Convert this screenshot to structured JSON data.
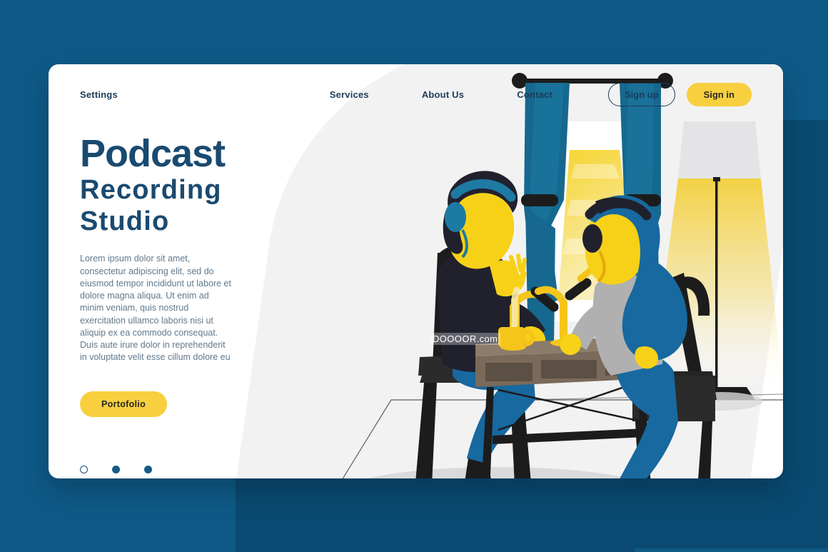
{
  "page": {
    "background_color": "#0e5a87",
    "blob_color": "#0a4a72",
    "card_color": "#ffffff"
  },
  "nav": {
    "brand": "Settings",
    "links": [
      {
        "label": "Services"
      },
      {
        "label": "About Us"
      },
      {
        "label": "Contact"
      }
    ],
    "sign_up": "Sign up",
    "sign_in": "Sign in",
    "accent_color": "#f7cf3f",
    "text_color": "#1d3c59"
  },
  "hero": {
    "title": "Podcast",
    "subtitle": "Recording Studio",
    "body": "Lorem ipsum dolor sit amet, consectetur adipiscing elit, sed do eiusmod tempor incididunt ut labore et dolore magna aliqua. Ut enim ad minim veniam, quis nostrud exercitation ullamco laboris nisi ut aliquip ex ea commodo consequat. Duis aute irure dolor in reprehenderit in voluptate velit esse cillum dolore eu",
    "cta_label": "Portofolio",
    "title_color": "#1a4a70",
    "body_color": "#61798c",
    "cta_color": "#f7cf3f"
  },
  "carousel": {
    "dots": [
      {
        "state": "hollow"
      },
      {
        "state": "filled"
      },
      {
        "state": "filled"
      }
    ]
  },
  "illustration": {
    "watermark": "DOOOOR.com",
    "alt": "Two people recording a podcast at a desk with microphones, a window with blue curtains and a floor lamp",
    "colors": {
      "skin": "#f7d117",
      "hair_dark": "#21212e",
      "hair_blue": "#1d6f9e",
      "sweater_dark": "#21212e",
      "sweater_gray": "#b0b0b0",
      "jeans": "#1769a0",
      "curtain": "#16688f",
      "desk": "#7b6a5a",
      "mic_stand": "#f5c51a",
      "furniture_black": "#1c1c1c",
      "lamp_light": "#f5d86a",
      "wall": "#f2f2f2"
    }
  }
}
